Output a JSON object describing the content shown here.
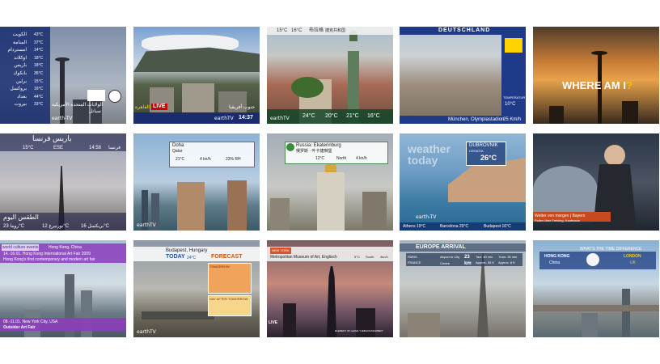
{
  "tiles": {
    "t1": {
      "header": "الولايات المتحدة الأمريكية",
      "sub": "سياتل",
      "list": [
        "الكويت",
        "المنامة",
        "امستردام",
        "اوكلاند",
        "باريس",
        "بانكوك",
        "برلين",
        "بروكسل",
        "بغداد",
        "بيروت"
      ],
      "temps": [
        "43°C",
        "37°C",
        "14°C",
        "18°C",
        "18°C",
        "35°C",
        "15°C",
        "16°C",
        "44°C",
        "33°C"
      ],
      "logo": "earth-TV"
    },
    "t2": {
      "badge": "LIVE",
      "channel": "القاهرة",
      "city": "جنوب أفريقيا",
      "time": "14:37",
      "logo": "earthTV"
    },
    "t3": {
      "top_left": "15°C",
      "top_mid": "16°C",
      "top_title": "布拉格",
      "top_sub": "捷克共和国",
      "temps": [
        "24°C",
        "20°C",
        "21°C",
        "16°C"
      ],
      "logo": "earthTV"
    },
    "t4": {
      "title": "DEUTSCHLAND",
      "temp_label": "TEMPERATUR",
      "temp": "10°C",
      "city": "München, Olympiastadion",
      "wind": "25 Km/h"
    },
    "t5": {
      "title": "WHERE AM I",
      "q": "?"
    },
    "t6": {
      "title": "باريس فرنسا",
      "temp": "15°C",
      "city": "فرنسا",
      "time": "14:58",
      "wind": "ESE",
      "bottom": "الطقس اليوم",
      "cities": [
        "روما 23°C",
        "نورنبرغ 12°C",
        "بريكسل 16°C"
      ]
    },
    "t7": {
      "city": "Doha",
      "country": "Qatar",
      "v1": "21°C",
      "v2": "4 kn/h",
      "v3": "23% RH",
      "logo": "earthTV"
    },
    "t8": {
      "city": "Russia: Ekaterinburg",
      "sub": "俄罗斯 · 叶卡捷琳堡",
      "v1": "12°C",
      "v2": "North",
      "v3": "4 kn/h"
    },
    "t9": {
      "city": "DUBROVNIK",
      "country": "CROATIA",
      "temp": "26°C",
      "watermark": "weather today",
      "ticker": [
        "Athens 19°C",
        "Barcelona 29°C",
        "Budapest 16°C"
      ],
      "logo": "earth-TV"
    },
    "t10": {
      "caption": "Wetter von morgen | Bayern",
      "caption2": "Pollen über Freising, Kaufmann"
    },
    "t11": {
      "tag": "world culture events",
      "city": "Hong Kong, China",
      "line1": "14.-16.01. Hong Kong International Art Fair 2009",
      "line2": "Hong Kong's first contemporary and modern art fair",
      "bottom1": "08.-11.01. New York City, USA",
      "bottom2": "Outsider Art Fair"
    },
    "t12": {
      "city": "Budapest, Hungary",
      "today": "TODAY",
      "temp": "24°C",
      "forecast": "FORECAST",
      "tomorrow": "TOMORROW",
      "after": "DAY AFTER TOMORROW",
      "logo": "earthTV"
    },
    "t13": {
      "city": "NEW YORK",
      "place": "Metropolitan Museum of Art, Englisch",
      "v1": "5°C",
      "v2": "South",
      "v3": "4kn/h",
      "badge": "LIVE",
      "note": "ELEMENT OF LEAVE \"LIEBLINGSFARBEN\""
    },
    "t14": {
      "title": "EUROPE ARRIVAL",
      "c1": "PARIS",
      "c1b": "FRANCE",
      "c2": "Airport to City Centre",
      "c3": "23 km",
      "c4": "Taxi: 40 min",
      "c4b": "Approx. 55 €",
      "c5": "Train: 35 min",
      "c5b": "Approx. 8 €"
    },
    "t15": {
      "title": "WHAT'S THE TIME DIFFERENCE",
      "c1": "HONG KONG",
      "c1b": "China",
      "c2": "LONDON",
      "c2b": "UK"
    }
  }
}
